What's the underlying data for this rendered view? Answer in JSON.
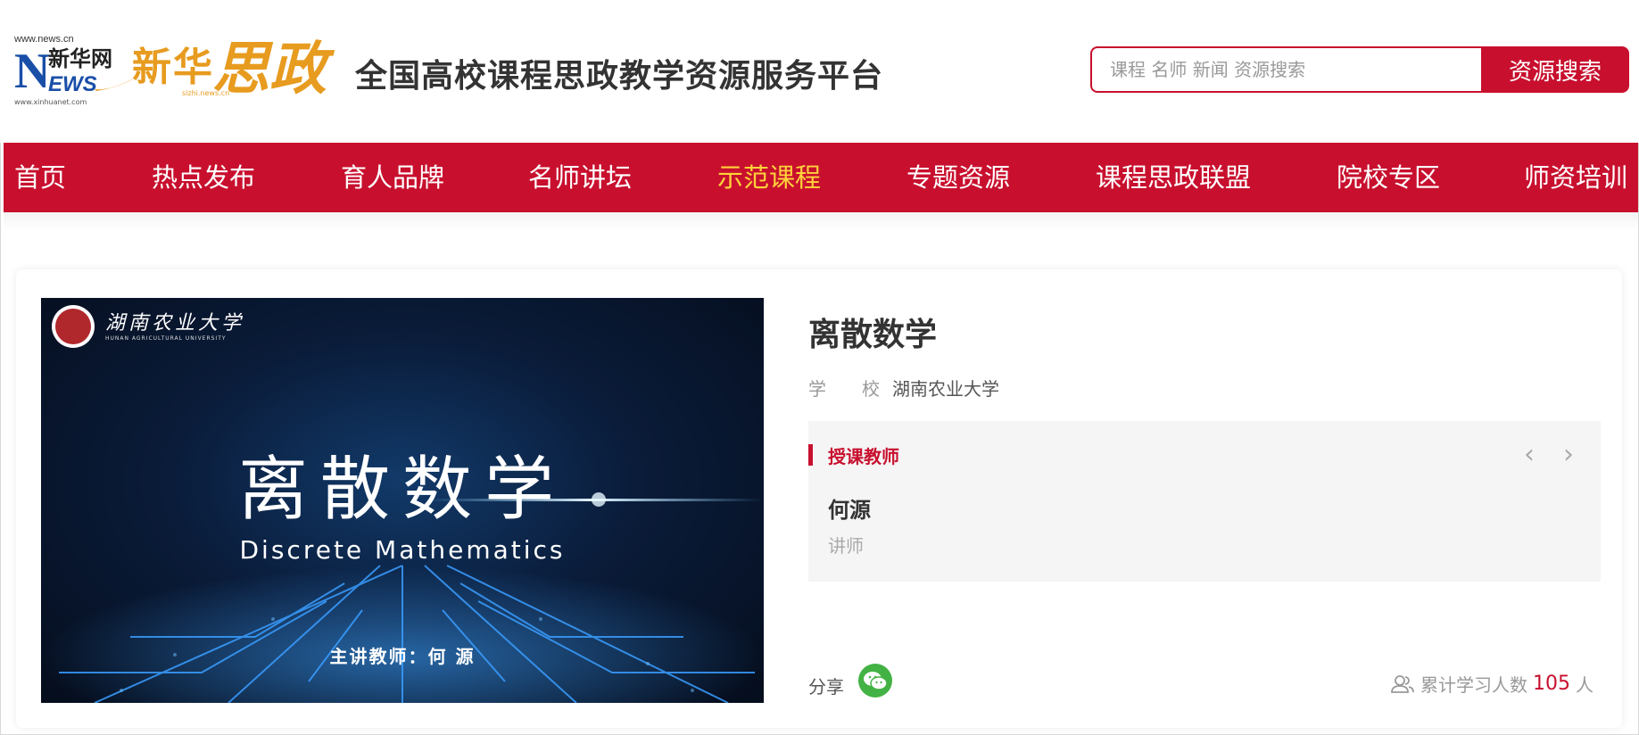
{
  "logo": {
    "news_url_top": "www.news.cn",
    "news_letter": "N",
    "news_cn": "新华网",
    "news_ews": "EWS",
    "news_url_bottom": "www.xinhuanet.com",
    "xinhua": "新华",
    "sizheng": "思政",
    "xinhua_url": "sizhi.news.cn"
  },
  "header": {
    "site_title": "全国高校课程思政教学资源服务平台"
  },
  "search": {
    "placeholder": "课程 名师 新闻 资源搜索",
    "button_label": "资源搜索"
  },
  "nav": {
    "items": [
      {
        "label": "首页"
      },
      {
        "label": "热点发布"
      },
      {
        "label": "育人品牌"
      },
      {
        "label": "名师讲坛"
      },
      {
        "label": "示范课程",
        "active": true
      },
      {
        "label": "专题资源"
      },
      {
        "label": "课程思政联盟"
      },
      {
        "label": "院校专区"
      },
      {
        "label": "师资培训"
      }
    ]
  },
  "cover": {
    "school_name": "湖南农业大学",
    "school_name_en": "HUNAN AGRICULTURAL UNIVERSITY",
    "title": "离散数学",
    "subtitle": "Discrete Mathematics",
    "teacher_line": "主讲教师：何 源"
  },
  "course": {
    "title": "离散数学",
    "school_label": "学　　校",
    "school_value": "湖南农业大学",
    "teacher_section_label": "授课教师",
    "teacher_name": "何源",
    "teacher_role": "讲师",
    "prev_icon": "chevron-left-icon",
    "next_icon": "chevron-right-icon"
  },
  "footer": {
    "share_label": "分享",
    "share_icon": "wechat-icon",
    "learners_prefix": "累计学习人数",
    "learners_count": "105",
    "learners_suffix": "人",
    "learners_icon": "users-icon"
  },
  "colors": {
    "brand_red": "#c8102e",
    "nav_active": "#ffd23a",
    "logo_gold": "#e79b1f",
    "wechat_green": "#43b244"
  }
}
